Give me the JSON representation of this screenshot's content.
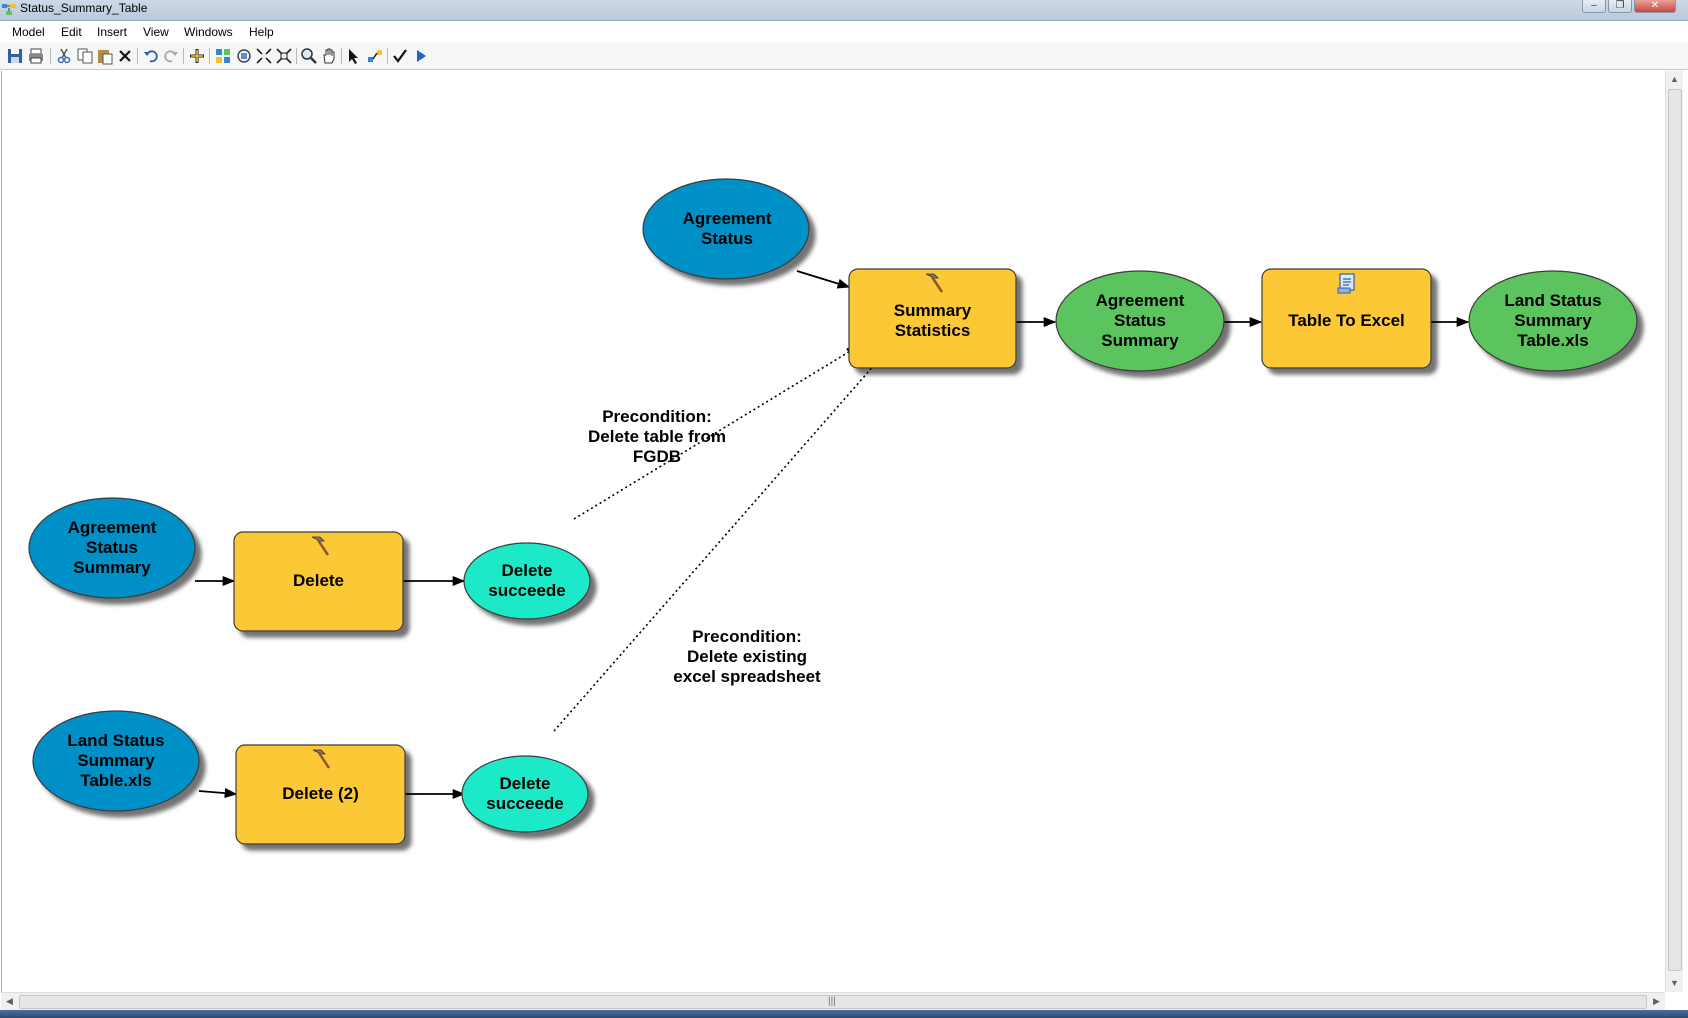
{
  "window": {
    "title": "Status_Summary_Table",
    "controls": {
      "minimize": "‒",
      "restore": "❐",
      "close": "✕"
    }
  },
  "menu": [
    "Model",
    "Edit",
    "Insert",
    "View",
    "Windows",
    "Help"
  ],
  "toolbar": {
    "icons": [
      "save-icon",
      "print-icon",
      "cut-icon",
      "copy-icon",
      "paste-icon",
      "delete-icon",
      "undo-icon",
      "redo-icon",
      "add-data-icon",
      "auto-layout-icon",
      "full-extent-icon",
      "fixed-zoom-in-icon",
      "fixed-zoom-out-icon",
      "zoom-icon",
      "pan-icon",
      "select-icon",
      "connect-icon",
      "validate-icon",
      "run-icon"
    ]
  },
  "colors": {
    "input_variable": "#0290c8",
    "tool": "#fdc834",
    "derived_data": "#5cc45f",
    "precondition_output": "#1de9c7",
    "outline": "#4a4a4a"
  },
  "model": {
    "input_variables": [
      {
        "id": "agreement-status",
        "label": "Agreement\nStatus"
      },
      {
        "id": "agreement-status-summary-input",
        "label": "Agreement\nStatus\nSummary"
      },
      {
        "id": "land-status-xls-input",
        "label": "Land Status\nSummary\nTable.xls"
      }
    ],
    "tools": [
      {
        "id": "summary-statistics",
        "label": "Summary\nStatistics",
        "icon": "hammer-icon"
      },
      {
        "id": "table-to-excel",
        "label": "Table To Excel",
        "icon": "script-icon"
      },
      {
        "id": "delete",
        "label": "Delete",
        "icon": "hammer-icon"
      },
      {
        "id": "delete-2",
        "label": "Delete (2)",
        "icon": "hammer-icon"
      }
    ],
    "derived_data": [
      {
        "id": "agreement-status-summary-output",
        "label": "Agreement\nStatus\nSummary"
      },
      {
        "id": "land-status-xls-output",
        "label": "Land Status\nSummary\nTable.xls"
      }
    ],
    "outputs": [
      {
        "id": "delete-succeeded-1",
        "label": "Delete\nsucceede"
      },
      {
        "id": "delete-succeeded-2",
        "label": "Delete\nsucceede"
      }
    ],
    "annotations": [
      {
        "id": "precondition-1",
        "text": "Precondition:\nDelete table from\nFGDB"
      },
      {
        "id": "precondition-2",
        "text": "Precondition:\nDelete existing\nexcel spreadsheet"
      }
    ]
  },
  "scrollbar": {
    "grip": "|||"
  }
}
